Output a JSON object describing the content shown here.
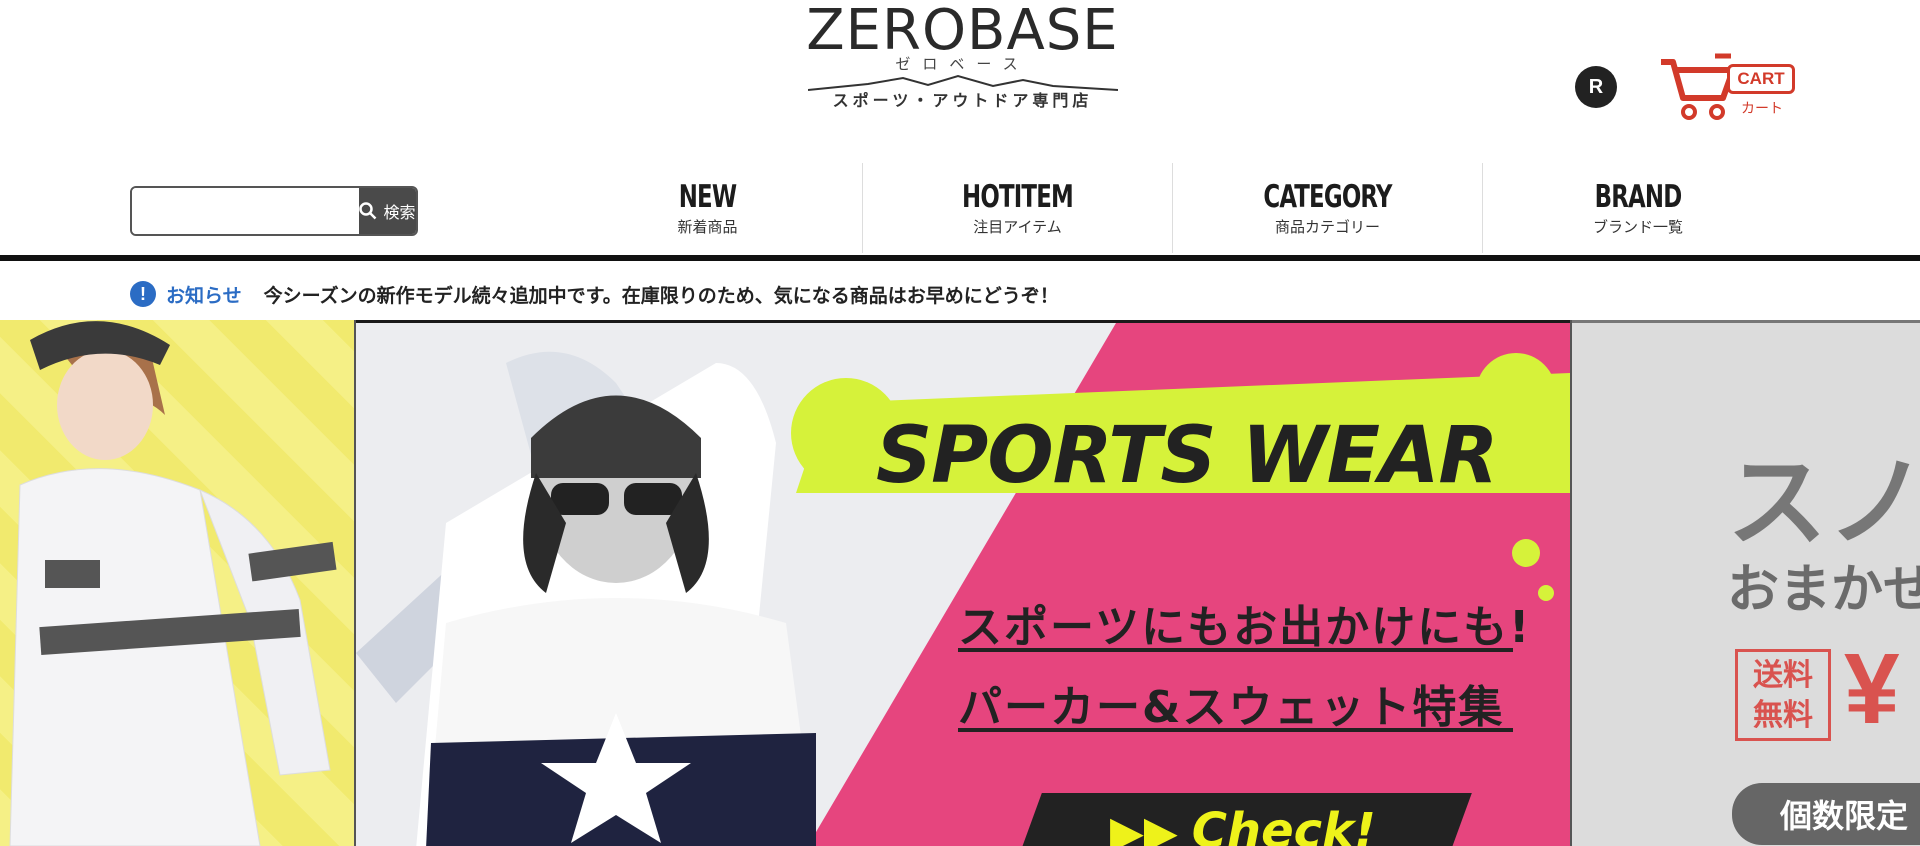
{
  "header": {
    "logo": {
      "main": "ZEROBASE",
      "kana": "ゼロベース",
      "sub": "スポーツ・アウトドア専門店"
    },
    "rakuten_badge": "R",
    "cart": {
      "label": "CART",
      "sub": "カート"
    }
  },
  "search": {
    "placeholder": "",
    "button_label": "検索"
  },
  "nav": [
    {
      "title": "NEW",
      "sub": "新着商品"
    },
    {
      "title": "HOTITEM",
      "sub": "注目アイテム"
    },
    {
      "title": "CATEGORY",
      "sub": "商品カテゴリー"
    },
    {
      "title": "BRAND",
      "sub": "ブランド一覧"
    }
  ],
  "notice": {
    "icon": "!",
    "label": "お知らせ",
    "text": "今シーズンの新作モデル続々追加中です。在庫限りのため、気になる商品はお早めにどうぞ！"
  },
  "banner": {
    "headline": "SPORTS WEAR",
    "copy1": "スポーツにもお出かけにも!",
    "copy2": "パーカー&スウェット特集",
    "cta": "Check!"
  },
  "banner_right": {
    "big": "スノ",
    "mid": "おまかせ",
    "stamp": "送料\n無料",
    "yen": "¥",
    "pill": "個数限定"
  },
  "colors": {
    "accent_blue": "#2b6cc4",
    "cart_red": "#d23a2a",
    "banner_pink": "#e6457e",
    "banner_lime": "#d6f23a"
  }
}
